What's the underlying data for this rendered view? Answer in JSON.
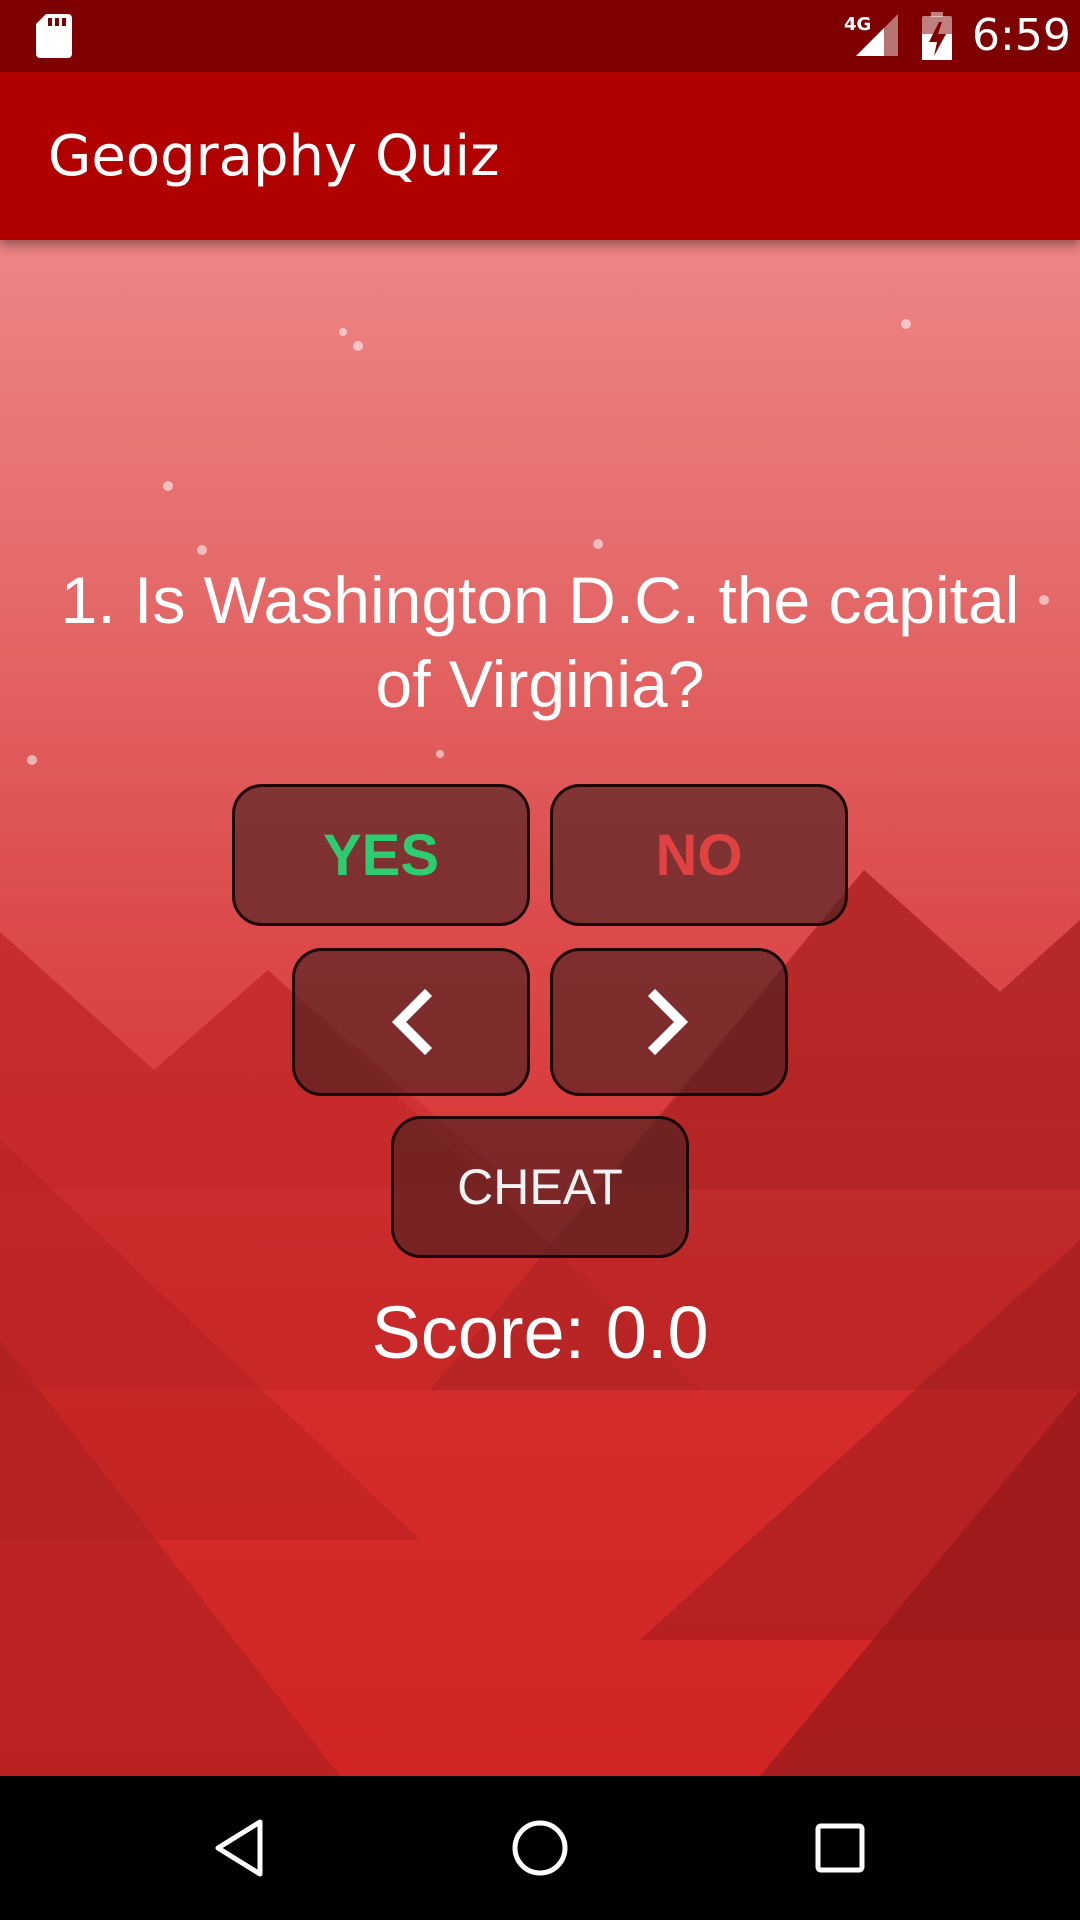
{
  "status_bar": {
    "network_label": "4G",
    "time": "6:59",
    "icons": [
      "sd-card-icon",
      "cell-signal-icon",
      "battery-charging-icon"
    ]
  },
  "app_bar": {
    "title": "Geography Quiz",
    "color": "#b00000"
  },
  "quiz": {
    "question": "1. Is Washington D.C. the capital of Virginia?",
    "yes_label": "YES",
    "no_label": "NO",
    "prev_icon": "chevron-left-icon",
    "next_icon": "chevron-right-icon",
    "cheat_label": "CHEAT",
    "score_text": "Score: 0.0"
  },
  "colors": {
    "status_bar": "#7f0000",
    "yes": "#2ecc71",
    "no": "#e04141",
    "button_bg": "#462020"
  },
  "nav_bar": {
    "icons": [
      "back-icon",
      "home-icon",
      "recents-icon"
    ]
  }
}
